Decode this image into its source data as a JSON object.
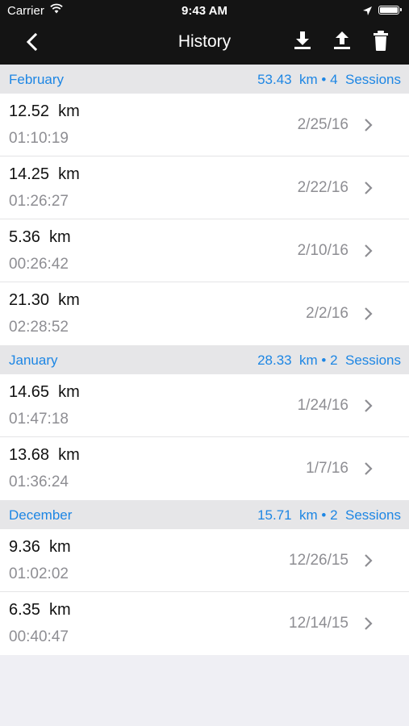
{
  "status_bar": {
    "carrier": "Carrier",
    "time": "9:43 AM"
  },
  "nav": {
    "title": "History",
    "back_icon": "chevron-left-icon",
    "actions": [
      "download-icon",
      "upload-icon",
      "trash-icon"
    ]
  },
  "colors": {
    "bar_background": "#141414",
    "accent": "#1d86e4",
    "section_background": "#e6e6e8",
    "secondary_text": "#8e8e93"
  },
  "sections": [
    {
      "month": "February",
      "summary": "53.43  km • 4  Sessions",
      "sessions": [
        {
          "distance": "12.52  km",
          "duration": "01:10:19",
          "date": "2/25/16"
        },
        {
          "distance": "14.25  km",
          "duration": "01:26:27",
          "date": "2/22/16"
        },
        {
          "distance": "5.36  km",
          "duration": "00:26:42",
          "date": "2/10/16"
        },
        {
          "distance": "21.30  km",
          "duration": "02:28:52",
          "date": "2/2/16"
        }
      ]
    },
    {
      "month": "January",
      "summary": "28.33  km • 2  Sessions",
      "sessions": [
        {
          "distance": "14.65  km",
          "duration": "01:47:18",
          "date": "1/24/16"
        },
        {
          "distance": "13.68  km",
          "duration": "01:36:24",
          "date": "1/7/16"
        }
      ]
    },
    {
      "month": "December",
      "summary": "15.71  km • 2  Sessions",
      "sessions": [
        {
          "distance": "9.36  km",
          "duration": "01:02:02",
          "date": "12/26/15"
        },
        {
          "distance": "6.35  km",
          "duration": "00:40:47",
          "date": "12/14/15"
        }
      ]
    }
  ]
}
